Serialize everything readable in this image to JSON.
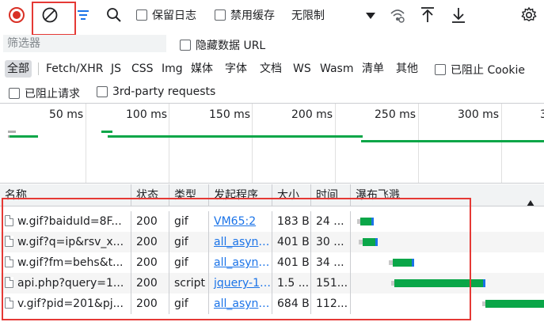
{
  "toolbar": {
    "preserve_log": "保留日志",
    "disable_cache": "禁用缓存",
    "throttle": "无限制"
  },
  "filter": {
    "placeholder": "筛选器",
    "hide_data_urls": "隐藏数据 URL"
  },
  "types": [
    {
      "label": "全部",
      "active": true
    },
    {
      "label": "Fetch/XHR"
    },
    {
      "label": "JS"
    },
    {
      "label": "CSS"
    },
    {
      "label": "Img"
    },
    {
      "label": "媒体"
    },
    {
      "label": "字体"
    },
    {
      "label": "文档"
    },
    {
      "label": "WS"
    },
    {
      "label": "Wasm"
    },
    {
      "label": "清单"
    },
    {
      "label": "其他"
    }
  ],
  "blocked_cookies": "已阻止 Cookie",
  "blocked_requests": "已阻止请求",
  "third_party": "3rd-party requests",
  "overview": {
    "ticks": [
      "50 ms",
      "100 ms",
      "150 ms",
      "200 ms",
      "250 ms",
      "300 ms",
      "3"
    ]
  },
  "columns": {
    "name": "名称",
    "status": "状态",
    "type": "类型",
    "initiator": "发起程序",
    "size": "大小",
    "time": "时间",
    "waterfall": "瀑布飞溅"
  },
  "rows": [
    {
      "name": "w.gif?baiduId=8F...",
      "status": "200",
      "type": "gif",
      "initiator": "VM65:2",
      "size": "183 B",
      "time": "24 ..."
    },
    {
      "name": "w.gif?q=ip&rsv_x...",
      "status": "200",
      "type": "gif",
      "initiator": "all_async...",
      "size": "401 B",
      "time": "30 ..."
    },
    {
      "name": "w.gif?fm=behs&t...",
      "status": "200",
      "type": "gif",
      "initiator": "all_async...",
      "size": "401 B",
      "time": "34 ..."
    },
    {
      "name": "api.php?query=1...",
      "status": "200",
      "type": "script",
      "initiator": "jquery-1....",
      "size": "1.5 ...",
      "time": "151..."
    },
    {
      "name": "v.gif?pid=201&pj...",
      "status": "200",
      "type": "gif",
      "initiator": "all_async...",
      "size": "684 B",
      "time": "112..."
    }
  ],
  "colors": {
    "accent": "#1a73e8",
    "record": "#d93025",
    "highlight": "#e53935",
    "bar_green": "#0aa648"
  }
}
